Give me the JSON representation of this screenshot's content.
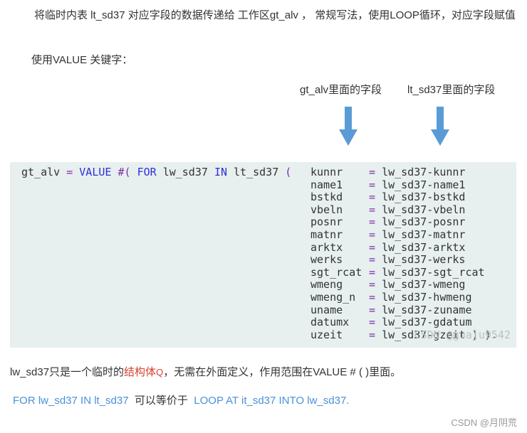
{
  "intro": "将临时内表 lt_sd37 对应字段的数据传递给 工作区gt_alv ， 常规写法，使用LOOP循环，对应字段赋值",
  "value_intro": "使用VALUE 关键字：",
  "labels": {
    "left": "gt_alv里面的字段",
    "right": "lt_sd37里面的字段"
  },
  "colors": {
    "arrow": "#5b9bd5",
    "code_bg": "#e8efef",
    "keyword": "#2f2fd8",
    "operator": "#7a2ea3",
    "link_red": "#d64030",
    "link_blue": "#4a90d9"
  },
  "code": {
    "target": "gt_alv",
    "eq": "=",
    "value_kw": "VALUE",
    "hash_paren": "#(",
    "for_kw": "FOR",
    "var": "lw_sd37",
    "in_kw": "IN",
    "table": "lt_sd37",
    "open_paren": "(",
    "rows": [
      {
        "field": "kunnr",
        "source": "lw_sd37-kunnr"
      },
      {
        "field": "name1",
        "source": "lw_sd37-name1"
      },
      {
        "field": "bstkd",
        "source": "lw_sd37-bstkd"
      },
      {
        "field": "vbeln",
        "source": "lw_sd37-vbeln"
      },
      {
        "field": "posnr",
        "source": "lw_sd37-posnr"
      },
      {
        "field": "matnr",
        "source": "lw_sd37-matnr"
      },
      {
        "field": "arktx",
        "source": "lw_sd37-arktx"
      },
      {
        "field": "werks",
        "source": "lw_sd37-werks"
      },
      {
        "field": "sgt_rcat",
        "source": "lw_sd37-sgt_rcat"
      },
      {
        "field": "wmeng",
        "source": "lw_sd37-wmeng"
      },
      {
        "field": "wmeng_n",
        "source": "lw_sd37-hwmeng"
      },
      {
        "field": "uname",
        "source": "lw_sd37-zuname"
      },
      {
        "field": "datumx",
        "source": "lw_sd37-gdatum"
      },
      {
        "field": "uzeit",
        "source": "lw_sd37-gzeit ) )."
      }
    ],
    "watermark": "CSDN @guaju9542"
  },
  "note": {
    "before": "lw_sd37只是一个临时的",
    "link": "结构体",
    "search_icon": "Q",
    "after": "，无需在外面定义，作用范围在VALUE # ( )里面。"
  },
  "equiv": {
    "left": "FOR lw_sd37 IN lt_sd37",
    "mid": "可以等价于",
    "right": "LOOP AT it_sd37 INTO lw_sd37."
  },
  "watermark": "CSDN @月阴荒"
}
